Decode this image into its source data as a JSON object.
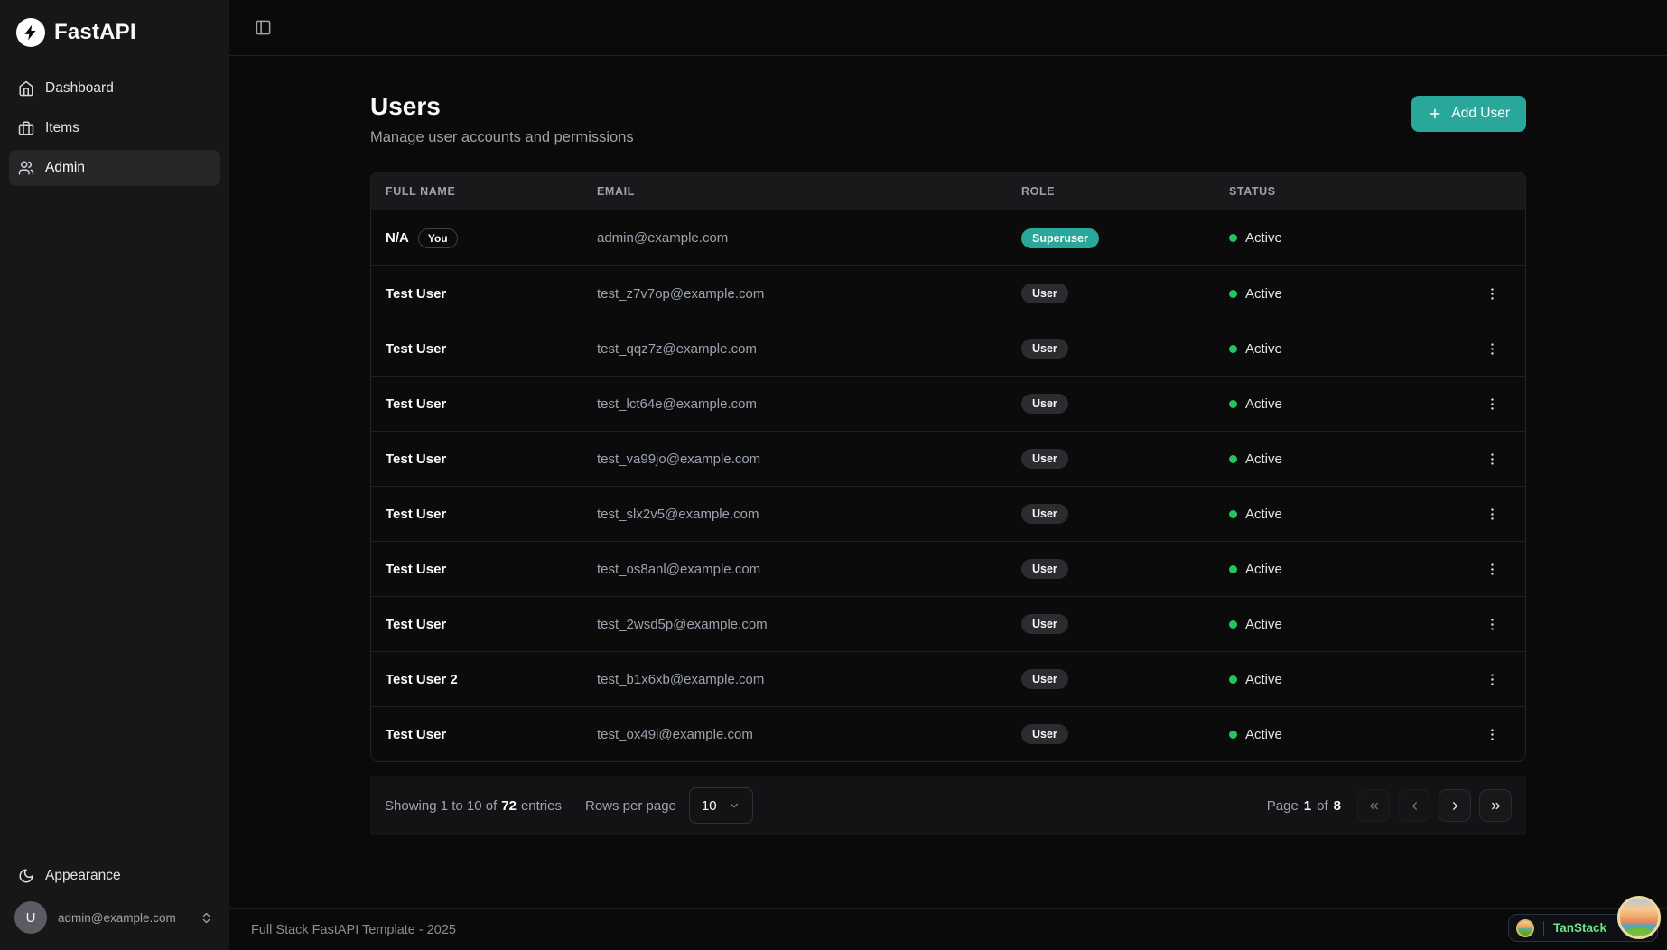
{
  "colors": {
    "accent": "#2aa79b",
    "status_active": "#22c55e"
  },
  "sidebar": {
    "brand": "FastAPI",
    "items": [
      {
        "label": "Dashboard",
        "icon": "home-icon",
        "active": false
      },
      {
        "label": "Items",
        "icon": "briefcase-icon",
        "active": false
      },
      {
        "label": "Admin",
        "icon": "users-icon",
        "active": true
      }
    ],
    "appearance_label": "Appearance",
    "user": {
      "initial": "U",
      "email": "admin@example.com"
    }
  },
  "main": {
    "title": "Users",
    "subtitle": "Manage user accounts and permissions",
    "add_user_label": "Add User",
    "table": {
      "columns": [
        "Full Name",
        "Email",
        "Role",
        "Status"
      ],
      "rows": [
        {
          "name": "N/A",
          "you_badge": "You",
          "email": "admin@example.com",
          "role": "Superuser",
          "role_variant": "superuser",
          "status": "Active",
          "has_actions": false
        },
        {
          "name": "Test User",
          "email": "test_z7v7op@example.com",
          "role": "User",
          "role_variant": "user",
          "status": "Active",
          "has_actions": true
        },
        {
          "name": "Test User",
          "email": "test_qqz7z@example.com",
          "role": "User",
          "role_variant": "user",
          "status": "Active",
          "has_actions": true
        },
        {
          "name": "Test User",
          "email": "test_lct64e@example.com",
          "role": "User",
          "role_variant": "user",
          "status": "Active",
          "has_actions": true
        },
        {
          "name": "Test User",
          "email": "test_va99jo@example.com",
          "role": "User",
          "role_variant": "user",
          "status": "Active",
          "has_actions": true
        },
        {
          "name": "Test User",
          "email": "test_slx2v5@example.com",
          "role": "User",
          "role_variant": "user",
          "status": "Active",
          "has_actions": true
        },
        {
          "name": "Test User",
          "email": "test_os8anl@example.com",
          "role": "User",
          "role_variant": "user",
          "status": "Active",
          "has_actions": true
        },
        {
          "name": "Test User",
          "email": "test_2wsd5p@example.com",
          "role": "User",
          "role_variant": "user",
          "status": "Active",
          "has_actions": true
        },
        {
          "name": "Test User 2",
          "email": "test_b1x6xb@example.com",
          "role": "User",
          "role_variant": "user",
          "status": "Active",
          "has_actions": true
        },
        {
          "name": "Test User",
          "email": "test_ox49i@example.com",
          "role": "User",
          "role_variant": "user",
          "status": "Active",
          "has_actions": true
        }
      ]
    },
    "pagination": {
      "showing_prefix": "Showing 1 to 10 of",
      "showing_total": "72",
      "showing_suffix": "entries",
      "rows_per_page_label": "Rows per page",
      "rows_per_page_value": "10",
      "page_label": "Page",
      "page_current": "1",
      "page_of": "of",
      "page_total": "8"
    },
    "footer": "Full Stack FastAPI Template - 2025"
  },
  "devtools": {
    "label": "TanStack"
  }
}
